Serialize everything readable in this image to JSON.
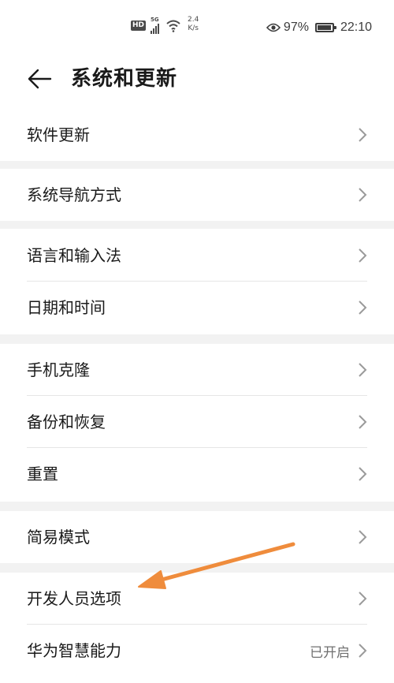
{
  "status_bar": {
    "hd": "HD",
    "network_gen": "5G",
    "speed_value": "2.4",
    "speed_unit": "K/s",
    "battery_percent": "97%",
    "battery_level": 0.97,
    "time": "22:10",
    "icons": [
      "eye-icon",
      "signal-icon",
      "wifi-icon",
      "battery-icon"
    ]
  },
  "header": {
    "title": "系统和更新",
    "back_icon": "arrow-left-icon"
  },
  "groups": [
    [
      {
        "label": "软件更新"
      }
    ],
    [
      {
        "label": "系统导航方式"
      }
    ],
    [
      {
        "label": "语言和输入法"
      },
      {
        "label": "日期和时间"
      }
    ],
    [
      {
        "label": "手机克隆"
      },
      {
        "label": "备份和恢复"
      },
      {
        "label": "重置"
      }
    ],
    [
      {
        "label": "简易模式"
      }
    ],
    [
      {
        "label": "开发人员选项"
      },
      {
        "label": "华为智慧能力",
        "value": "已开启"
      }
    ]
  ],
  "colors": {
    "background": "#ffffff",
    "group_gap": "#f2f2f2",
    "text": "#1a1a1a",
    "secondary_text": "#707070",
    "chevron": "#9a9a9a",
    "annotation_arrow": "#ef8c3c"
  }
}
